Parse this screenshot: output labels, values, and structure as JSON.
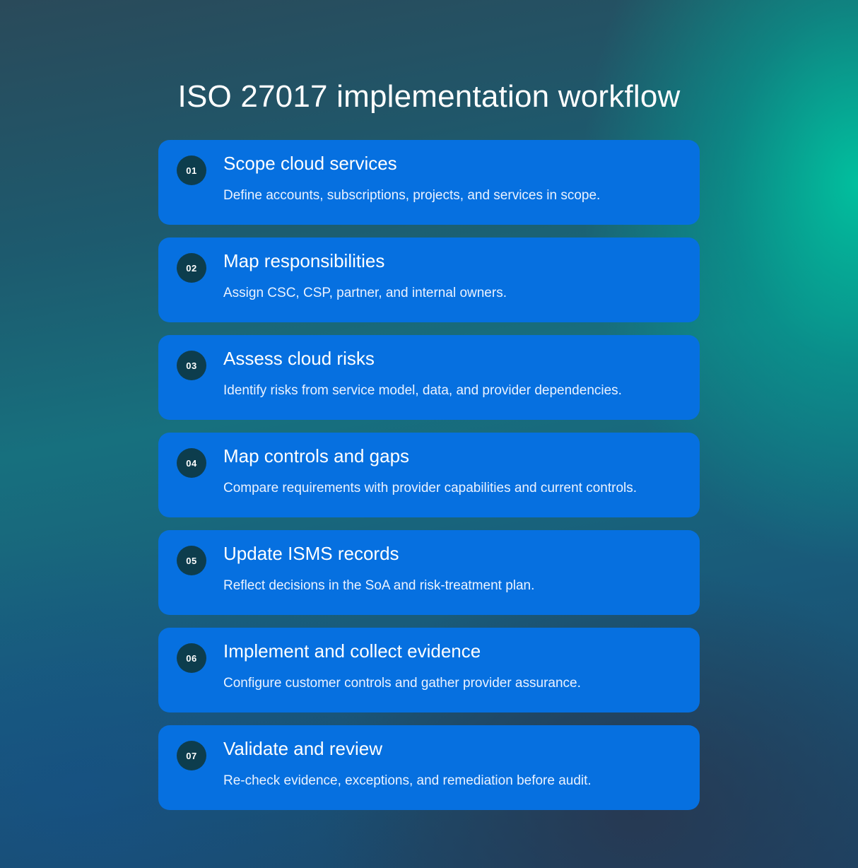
{
  "header": {
    "title": "ISO 27017 implementation workflow"
  },
  "colors": {
    "card": "#0670e0",
    "badge": "#0d3d4d",
    "text": "#ffffff"
  },
  "steps": [
    {
      "number": "01",
      "title": "Scope cloud services",
      "description": "Define accounts, subscriptions, projects, and services in scope."
    },
    {
      "number": "02",
      "title": "Map responsibilities",
      "description": "Assign CSC, CSP, partner, and internal owners."
    },
    {
      "number": "03",
      "title": "Assess cloud risks",
      "description": "Identify risks from service model, data, and provider dependencies."
    },
    {
      "number": "04",
      "title": "Map controls and gaps",
      "description": "Compare requirements with provider capabilities and current controls."
    },
    {
      "number": "05",
      "title": "Update ISMS records",
      "description": "Reflect decisions in the SoA and risk-treatment plan."
    },
    {
      "number": "06",
      "title": "Implement and collect evidence",
      "description": "Configure customer controls and gather provider assurance."
    },
    {
      "number": "07",
      "title": "Validate and review",
      "description": "Re-check evidence, exceptions, and remediation before audit."
    }
  ]
}
